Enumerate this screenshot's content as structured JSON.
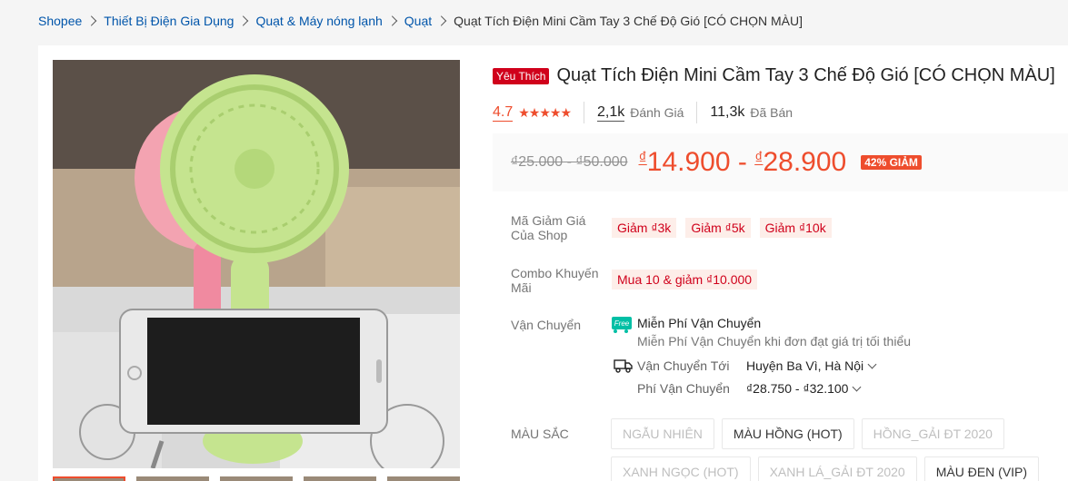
{
  "breadcrumb": [
    {
      "label": "Shopee"
    },
    {
      "label": "Thiết Bị Điện Gia Dụng"
    },
    {
      "label": "Quạt & Máy nóng lạnh"
    },
    {
      "label": "Quạt"
    },
    {
      "label": "Quạt Tích Điện Mini Cầm Tay 3 Chế Độ Gió [CÓ CHỌN MÀU]"
    }
  ],
  "product": {
    "badge": "Yêu Thích",
    "title": "Quạt Tích Điện Mini Cầm Tay 3 Chế Độ Gió [CÓ CHỌN MÀU]",
    "rating": "4.7",
    "stars": "★★★★★",
    "reviews_count": "2,1k",
    "reviews_label": "Đánh Giá",
    "sold_count": "11,3k",
    "sold_label": "Đã Bán",
    "old_price": "₫25.000 - ₫50.000",
    "price_currency": "₫",
    "price_low": "14.900",
    "price_sep": " - ",
    "price_high": "28.900",
    "discount": "42% GIẢM"
  },
  "details": {
    "voucher_label": "Mã Giảm Giá Của Shop",
    "vouchers": [
      "Giảm ₫3k",
      "Giảm ₫5k",
      "Giảm ₫10k"
    ],
    "combo_label": "Combo Khuyến Mãi",
    "combo": "Mua 10 & giảm ₫10.000",
    "shipping_label": "Vận Chuyển",
    "free_icon_text": "Free",
    "free_ship_title": "Miễn Phí Vận Chuyển",
    "free_ship_sub": "Miễn Phí Vận Chuyển khi đơn đạt giá trị tối thiểu",
    "ship_to_label": "Vận Chuyển Tới",
    "ship_to_value": "Huyện Ba Vì, Hà Nội",
    "ship_fee_label": "Phí Vận Chuyển",
    "ship_fee_value": "₫28.750 - ₫32.100",
    "color_label": "MÀU SẮC",
    "colors": [
      {
        "label": "NGẪU NHIÊN",
        "disabled": true
      },
      {
        "label": "MÀU HỒNG (HOT)",
        "disabled": false
      },
      {
        "label": "HỒNG_GẢI ĐT 2020",
        "disabled": true
      },
      {
        "label": "XANH NGỌC (HOT)",
        "disabled": true
      },
      {
        "label": "XANH LÁ_GẢI ĐT 2020",
        "disabled": true
      },
      {
        "label": "MÀU ĐEN (VIP)",
        "disabled": false
      }
    ]
  },
  "colors": {
    "accent": "#ee4d2d",
    "badge_red": "#d0011b",
    "link": "#0055aa",
    "free_ship": "#00bfa5"
  }
}
